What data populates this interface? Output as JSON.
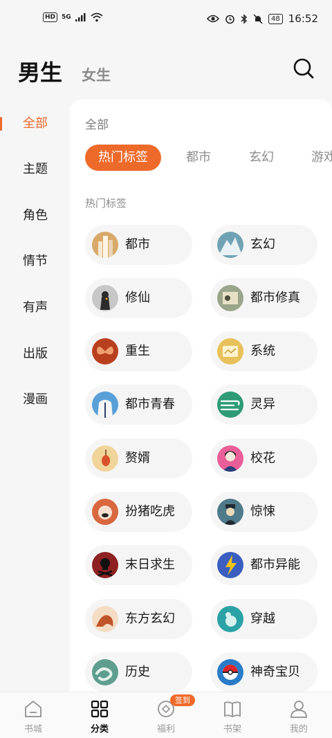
{
  "status_bar": {
    "hd": "HD",
    "network": "5G",
    "battery": "48",
    "time": "16:52"
  },
  "header": {
    "male_tab": "男生",
    "female_tab": "女生",
    "search_icon": "search-icon"
  },
  "side_nav": [
    {
      "label": "全部",
      "active": true
    },
    {
      "label": "主题"
    },
    {
      "label": "角色"
    },
    {
      "label": "情节"
    },
    {
      "label": "有声"
    },
    {
      "label": "出版"
    },
    {
      "label": "漫画"
    }
  ],
  "panel": {
    "title": "全部",
    "chips": [
      {
        "label": "热门标签",
        "active": true
      },
      {
        "label": "都市"
      },
      {
        "label": "玄幻"
      },
      {
        "label": "游戏"
      }
    ],
    "section_label": "热门标签",
    "tags": [
      {
        "label": "都市",
        "icon": "city-buildings-icon",
        "color": "#d9a96a"
      },
      {
        "label": "玄幻",
        "icon": "mountain-icon",
        "color": "#6fa3b4"
      },
      {
        "label": "修仙",
        "icon": "immortal-figure-icon",
        "color": "#c7c7c7"
      },
      {
        "label": "都市修真",
        "icon": "scroll-icon",
        "color": "#9aa58b"
      },
      {
        "label": "重生",
        "icon": "butterfly-icon",
        "color": "#b9401f"
      },
      {
        "label": "系统",
        "icon": "screen-icon",
        "color": "#e7c15a"
      },
      {
        "label": "都市青春",
        "icon": "jacket-icon",
        "color": "#5aa0d8"
      },
      {
        "label": "灵异",
        "icon": "wind-icon",
        "color": "#2f9b77"
      },
      {
        "label": "赘婿",
        "icon": "lantern-icon",
        "color": "#f0d49a"
      },
      {
        "label": "校花",
        "icon": "girl-icon",
        "color": "#ea5f98"
      },
      {
        "label": "扮猪吃虎",
        "icon": "pig-icon",
        "color": "#d9683f"
      },
      {
        "label": "惊悚",
        "icon": "zombie-icon",
        "color": "#4f7a8a"
      },
      {
        "label": "末日求生",
        "icon": "skull-icon",
        "color": "#8e2121"
      },
      {
        "label": "都市异能",
        "icon": "lightning-icon",
        "color": "#3a5fc0"
      },
      {
        "label": "东方玄幻",
        "icon": "dragon-icon",
        "color": "#f4ddc4"
      },
      {
        "label": "穿越",
        "icon": "portal-icon",
        "color": "#2ba2a6"
      },
      {
        "label": "历史",
        "icon": "swirl-icon",
        "color": "#5f9e8e"
      },
      {
        "label": "神奇宝贝",
        "icon": "pokeball-icon",
        "color": "#2a7bc8"
      }
    ]
  },
  "tab_bar": {
    "tabs": [
      {
        "label": "书城",
        "icon": "bookstore-icon"
      },
      {
        "label": "分类",
        "icon": "category-grid-icon",
        "active": true
      },
      {
        "label": "福利",
        "icon": "coin-icon"
      },
      {
        "label": "书架",
        "icon": "bookshelf-icon"
      },
      {
        "label": "我的",
        "icon": "profile-icon"
      }
    ],
    "checkin_badge": "签到"
  },
  "colors": {
    "accent": "#ed6a2b",
    "panel_bg": "#ffffff",
    "page_bg": "#f6f6f6",
    "tag_bg": "#f5f5f5"
  }
}
